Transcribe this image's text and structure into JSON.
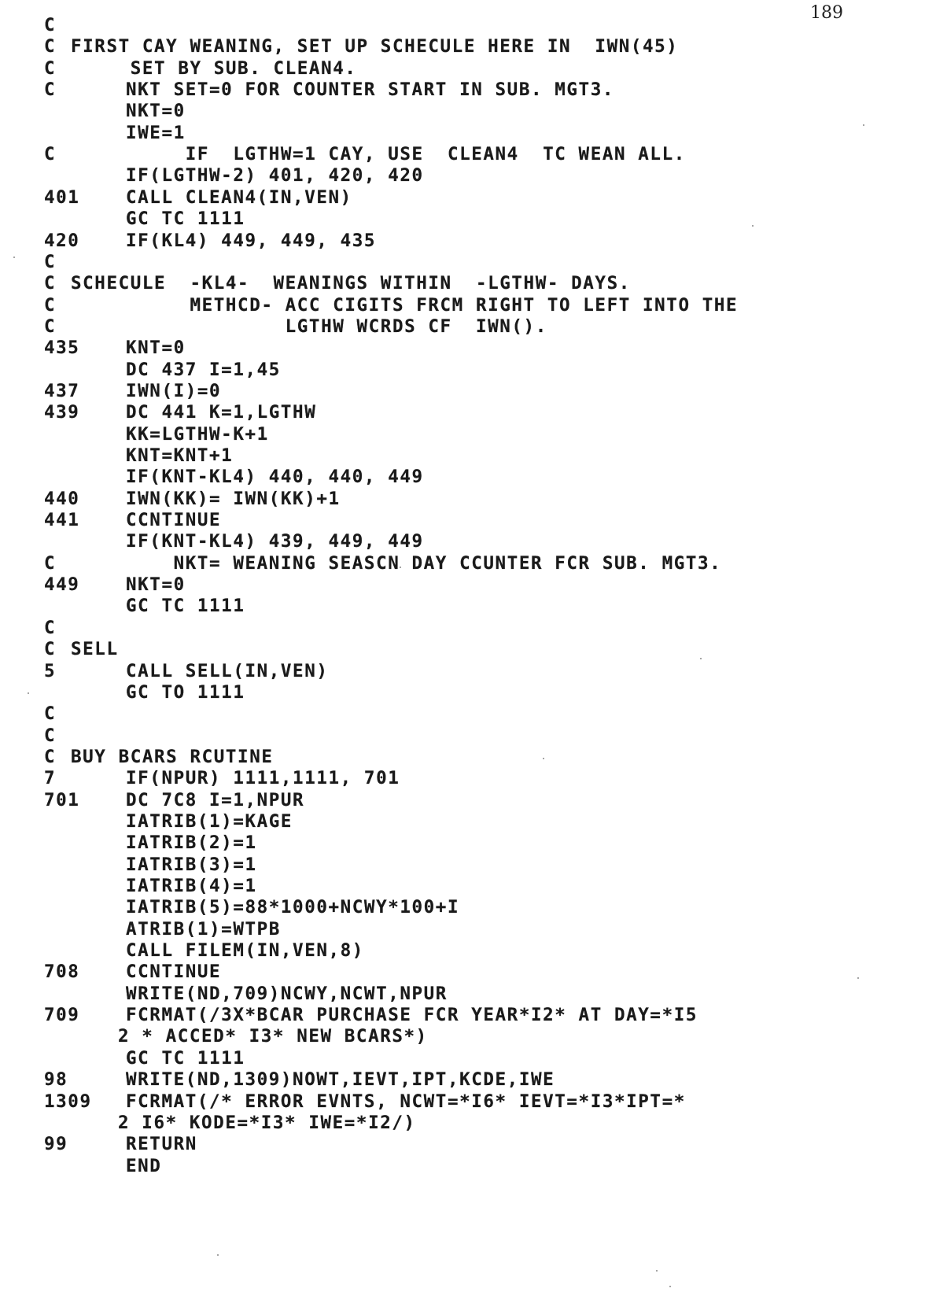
{
  "page": {
    "number": "189"
  },
  "listing": {
    "language": "FORTRAN",
    "lines": [
      {
        "label": "C",
        "text": ""
      },
      {
        "label": "C",
        "text": "FIRST CAY WEANING, SET UP SCHECULE HERE IN  IWN(45)",
        "kind": "comment-inline"
      },
      {
        "label": "C",
        "text": "     SET BY SUB. CLEAN4.",
        "kind": "comment-inline"
      },
      {
        "label": "C",
        "text": "NKT SET=0 FOR COUNTER START IN SUB. MGT3.",
        "kind": "comment"
      },
      {
        "label": "",
        "text": "NKT=0"
      },
      {
        "label": "",
        "text": "IWE=1"
      },
      {
        "label": "C",
        "text": "     IF  LGTHW=1 CAY, USE  CLEAN4  TC WEAN ALL.",
        "kind": "comment"
      },
      {
        "label": "",
        "text": "IF(LGTHW-2) 401, 420, 420"
      },
      {
        "label": "401",
        "text": "CALL CLEAN4(IN,VEN)"
      },
      {
        "label": "",
        "text": "GC TC 1111"
      },
      {
        "label": "420",
        "text": "IF(KL4) 449, 449, 435"
      },
      {
        "label": "C",
        "text": ""
      },
      {
        "label": "C",
        "text": "SCHECULE  -KL4-  WEANINGS WITHIN  -LGTHW- DAYS.",
        "kind": "comment-inline"
      },
      {
        "label": "C",
        "text": "          METHCD- ACC CIGITS FRCM RIGHT TO LEFT INTO THE",
        "kind": "comment-inline"
      },
      {
        "label": "C",
        "text": "                  LGTHW WCRDS CF  IWN().",
        "kind": "comment-inline"
      },
      {
        "label": "435",
        "text": "KNT=0"
      },
      {
        "label": "",
        "text": "DC 437 I=1,45"
      },
      {
        "label": "437",
        "text": "IWN(I)=0"
      },
      {
        "label": "439",
        "text": "DC 441 K=1,LGTHW"
      },
      {
        "label": "",
        "text": "KK=LGTHW-K+1"
      },
      {
        "label": "",
        "text": "KNT=KNT+1"
      },
      {
        "label": "",
        "text": "IF(KNT-KL4) 440, 440, 449"
      },
      {
        "label": "440",
        "text": "IWN(KK)= IWN(KK)+1"
      },
      {
        "label": "441",
        "text": "CCNTINUE"
      },
      {
        "label": "",
        "text": "IF(KNT-KL4) 439, 449, 449"
      },
      {
        "label": "C",
        "text": "    NKT= WEANING SEASCN DAY CCUNTER FCR SUB. MGT3.",
        "kind": "comment"
      },
      {
        "label": "449",
        "text": "NKT=0"
      },
      {
        "label": "",
        "text": "GC TC 1111"
      },
      {
        "label": "C",
        "text": ""
      },
      {
        "label": "C",
        "text": "SELL",
        "kind": "comment-inline"
      },
      {
        "label": "5",
        "text": "CALL SELL(IN,VEN)"
      },
      {
        "label": "",
        "text": "GC TO 1111"
      },
      {
        "label": "C",
        "text": ""
      },
      {
        "label": "C",
        "text": ""
      },
      {
        "label": "C",
        "text": "BUY BCARS RCUTINE",
        "kind": "comment-inline"
      },
      {
        "label": "7",
        "text": "IF(NPUR) 1111,1111, 701"
      },
      {
        "label": "701",
        "text": "DC 7C8 I=1,NPUR"
      },
      {
        "label": "",
        "text": "IATRIB(1)=KAGE"
      },
      {
        "label": "",
        "text": "IATRIB(2)=1"
      },
      {
        "label": "",
        "text": "IATRIB(3)=1"
      },
      {
        "label": "",
        "text": "IATRIB(4)=1"
      },
      {
        "label": "",
        "text": "IATRIB(5)=88*1000+NCWY*100+I"
      },
      {
        "label": "",
        "text": "ATRIB(1)=WTPB"
      },
      {
        "label": "",
        "text": "CALL FILEM(IN,VEN,8)"
      },
      {
        "label": "708",
        "text": "CCNTINUE"
      },
      {
        "label": "",
        "text": "WRITE(ND,709)NCWY,NCWT,NPUR"
      },
      {
        "label": "709",
        "text": "FCRMAT(/3X*BCAR PURCHASE FCR YEAR*I2* AT DAY=*I5"
      },
      {
        "label": "",
        "text": "2 * ACCED* I3* NEW BCARS*)",
        "kind": "continuation"
      },
      {
        "label": "",
        "text": "GC TC 1111"
      },
      {
        "label": "98",
        "text": "WRITE(ND,1309)NOWT,IEVT,IPT,KCDE,IWE"
      },
      {
        "label": "1309",
        "text": "FCRMAT(/* ERROR EVNTS, NCWT=*I6* IEVT=*I3*IPT=*"
      },
      {
        "label": "",
        "text": "2 I6* KODE=*I3* IWE=*I2/)",
        "kind": "continuation"
      },
      {
        "label": "99",
        "text": "RETURN"
      },
      {
        "label": "",
        "text": "END"
      }
    ]
  }
}
